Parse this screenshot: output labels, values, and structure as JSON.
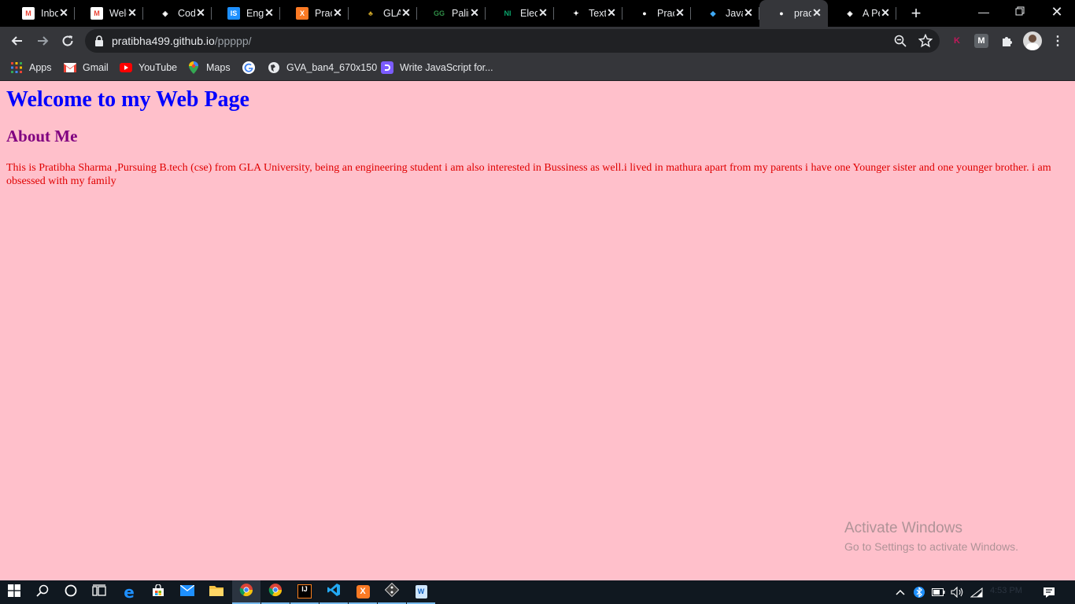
{
  "browser": {
    "tabs": [
      {
        "title": "Inbo",
        "icon": "gmail-icon",
        "color": "#ea4335"
      },
      {
        "title": "Welc",
        "icon": "gmail-icon",
        "color": "#ea4335"
      },
      {
        "title": "Code",
        "icon": "codepen-icon",
        "color": "#ffffff"
      },
      {
        "title": "Engl",
        "icon": "is-icon",
        "color": "#1e90ff"
      },
      {
        "title": "Prac",
        "icon": "xampp-icon",
        "color": "#fb7a24"
      },
      {
        "title": "GLA",
        "icon": "gla-icon",
        "color": "#c9a227"
      },
      {
        "title": "Palin",
        "icon": "gfg-icon",
        "color": "#2f8d46"
      },
      {
        "title": "Elect",
        "icon": "ni-icon",
        "color": "#0aa36b"
      },
      {
        "title": "Text",
        "icon": "text-icon",
        "color": "#ffffff"
      },
      {
        "title": "Prac",
        "icon": "globe-icon",
        "color": "#ffffff"
      },
      {
        "title": "Java",
        "icon": "java-icon",
        "color": "#3fa9f5"
      },
      {
        "title": "prac",
        "icon": "globe-icon",
        "color": "#ffffff",
        "active": true
      },
      {
        "title": "A Pe",
        "icon": "codepen-icon",
        "color": "#ffffff"
      }
    ],
    "new_tab_label": "+",
    "address": {
      "host": "pratibha499.github.io",
      "path": "/ppppp/"
    }
  },
  "bookmarks": [
    {
      "label": "Apps",
      "icon": "apps-grid-icon"
    },
    {
      "label": "Gmail",
      "icon": "gmail-icon"
    },
    {
      "label": "YouTube",
      "icon": "youtube-icon"
    },
    {
      "label": "Maps",
      "icon": "maps-pin-icon"
    },
    {
      "label": "",
      "icon": "google-icon"
    },
    {
      "label": "GVA_ban4_670x150",
      "icon": "globe-icon"
    },
    {
      "label": "Write JavaScript for...",
      "icon": "js-site-icon"
    }
  ],
  "page": {
    "heading": "Welcome to my Web Page",
    "subheading": "About Me",
    "paragraph": "This is Pratibha Sharma ,Pursuing B.tech (cse) from GLA University, being an engineering student i am also interested in Bussiness as well.i lived in mathura apart from my parents i have one Younger sister and one younger brother. i am obsessed with my family",
    "colors": {
      "background": "#ffc0cb",
      "heading": "#0000ff",
      "subheading": "#800080",
      "paragraph": "#e00000"
    }
  },
  "watermark": {
    "line1": "Activate Windows",
    "line2": "Go to Settings to activate Windows."
  },
  "taskbar": {
    "clock": "4:53 PM"
  }
}
